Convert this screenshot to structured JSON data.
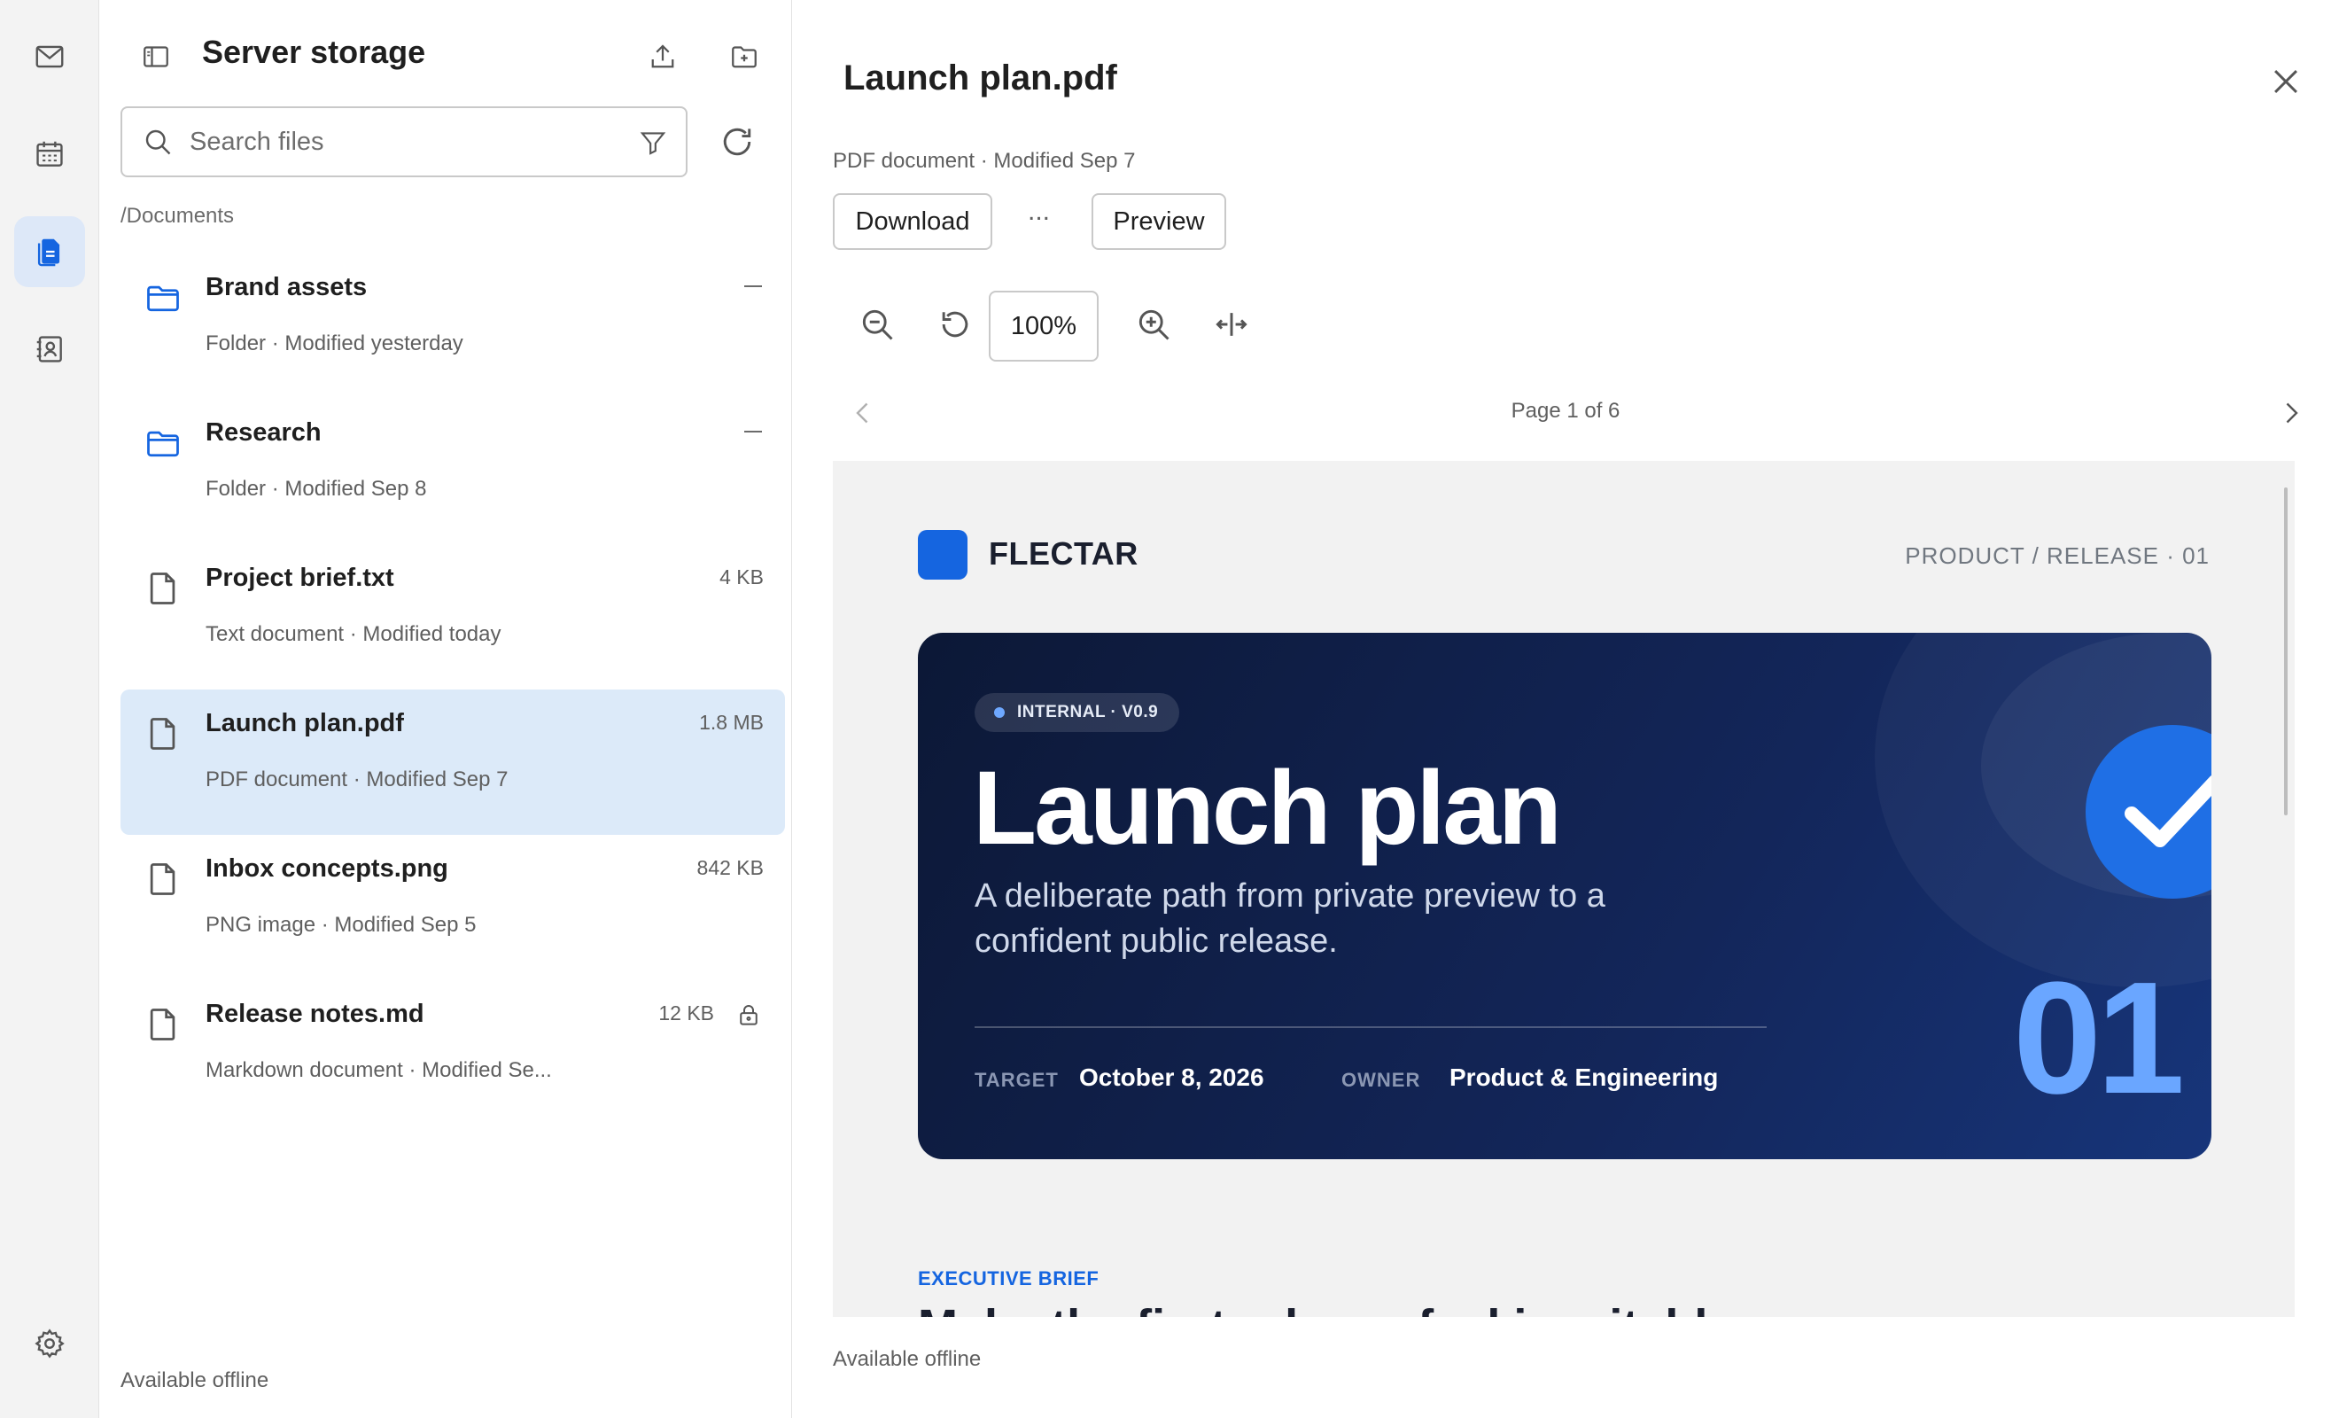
{
  "files_panel": {
    "title": "Server storage",
    "search_placeholder": "Search files",
    "path": "/Documents",
    "footer": "Available offline",
    "items": [
      {
        "name": "Brand assets",
        "meta": "Folder · Modified yesterday",
        "size": "",
        "type": "folder"
      },
      {
        "name": "Research",
        "meta": "Folder · Modified Sep 8",
        "size": "",
        "type": "folder"
      },
      {
        "name": "Project brief.txt",
        "meta": "Text document · Modified today",
        "size": "4 KB",
        "type": "file"
      },
      {
        "name": "Launch plan.pdf",
        "meta": "PDF document · Modified Sep 7",
        "size": "1.8 MB",
        "type": "file",
        "selected": true
      },
      {
        "name": "Inbox concepts.png",
        "meta": "PNG image · Modified Sep 5",
        "size": "842 KB",
        "type": "file"
      },
      {
        "name": "Release notes.md",
        "meta": "Markdown document · Modified Se...",
        "size": "12 KB",
        "type": "file",
        "locked": true
      }
    ]
  },
  "preview": {
    "title": "Launch plan.pdf",
    "meta": "PDF document · Modified Sep 7",
    "download_label": "Download",
    "more_label": "...",
    "preview_label": "Preview",
    "zoom": "100%",
    "page_indicator": "Page 1 of 6",
    "footer": "Available offline"
  },
  "document": {
    "brand": "FLECTAR",
    "tag": "PRODUCT / RELEASE · 01",
    "pill": "INTERNAL · V0.9",
    "title": "Launch plan",
    "subtitle": "A deliberate path from private preview to a confident public release.",
    "target_label": "TARGET",
    "target_value": "October 8, 2026",
    "owner_label": "OWNER",
    "owner_value": "Product & Engineering",
    "number": "01",
    "section_label": "EXECUTIVE BRIEF",
    "section_heading": "Make the first release feel inevitable"
  },
  "colors": {
    "accent": "#1565e0",
    "selected_bg": "#dceaf9",
    "hero_bg": "#0c1836"
  }
}
